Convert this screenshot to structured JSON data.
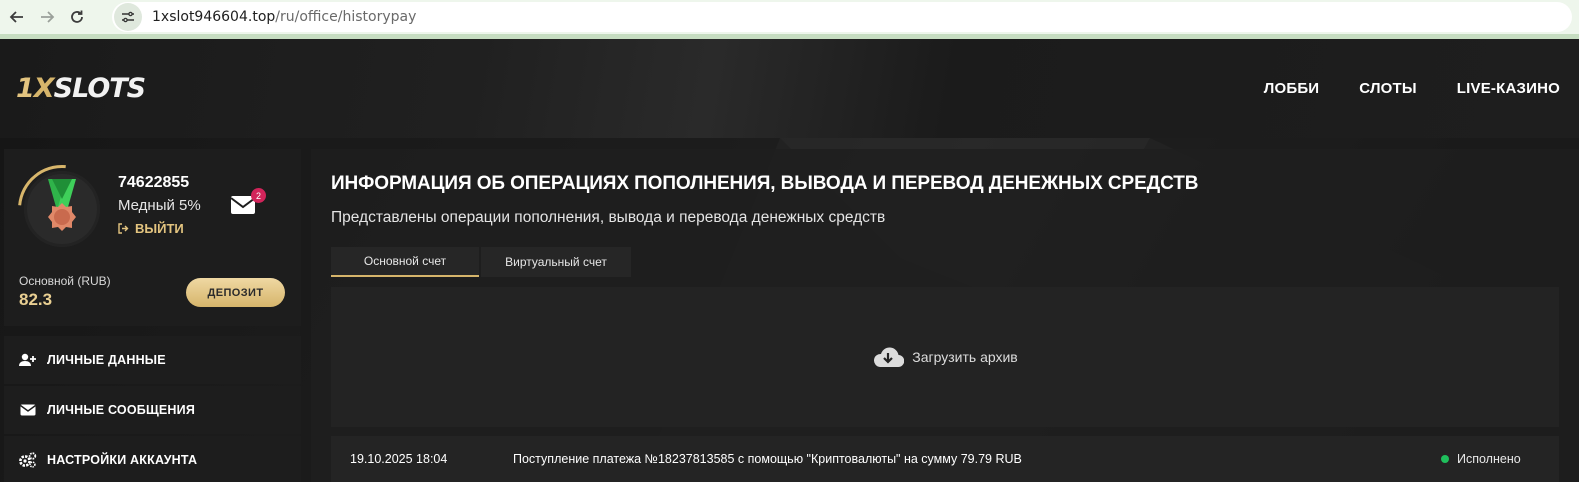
{
  "browser": {
    "url_host": "1xslot946604.top",
    "url_path": "/ru/office/historypay"
  },
  "header": {
    "logo": {
      "one": "1",
      "x": "X",
      "slots": "SLOTS"
    },
    "nav": [
      "ЛОББИ",
      "СЛОТЫ",
      "LIVE-КАЗИНО"
    ]
  },
  "profile": {
    "user_id": "74622855",
    "level": "Медный 5%",
    "logout_label": "ВЫЙТИ",
    "messages_badge": "2",
    "balance_label": "Основной (RUB)",
    "balance_value": "82.3",
    "deposit_label": "ДЕПОЗИТ"
  },
  "menu": [
    {
      "label": "ЛИЧНЫЕ ДАННЫЕ",
      "icon": "user-plus-icon"
    },
    {
      "label": "ЛИЧНЫЕ СООБЩЕНИЯ",
      "icon": "envelope-icon"
    },
    {
      "label": "НАСТРОЙКИ АККАУНТА",
      "icon": "gears-icon"
    }
  ],
  "main": {
    "title": "ИНФОРМАЦИЯ ОБ ОПЕРАЦИЯХ ПОПОЛНЕНИЯ, ВЫВОДА И ПЕРЕВОД ДЕНЕЖНЫХ СРЕДСТВ",
    "subtitle": "Представлены операции пополнения, вывода и перевода денежных средств",
    "tabs": [
      "Основной счет",
      "Виртуальный счет"
    ],
    "archive_label": "Загрузить архив",
    "history": [
      {
        "date": "19.10.2025 18:04",
        "description": "Поступление платежа №18237813585 с помощью \"Криптовалюты\" на сумму 79.79 RUB",
        "status": "Исполнено"
      }
    ]
  },
  "colors": {
    "accent_gold": "#d6b56b",
    "status_done": "#1fbf5c",
    "badge": "#d2245a"
  }
}
